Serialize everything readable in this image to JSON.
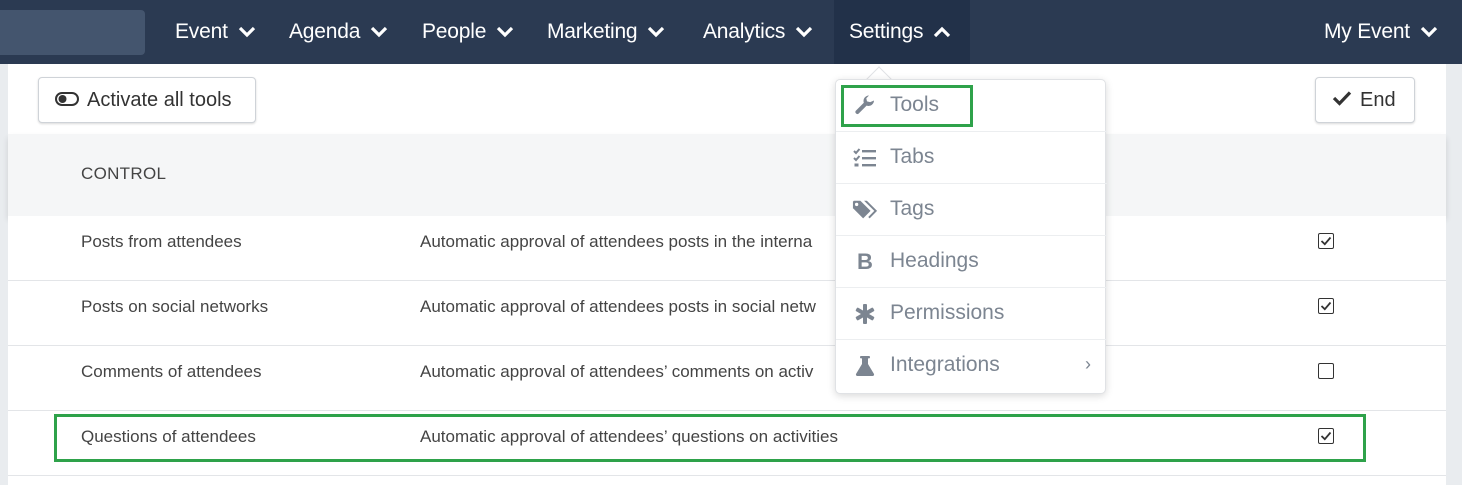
{
  "nav": {
    "items": [
      {
        "label": "Event"
      },
      {
        "label": "Agenda"
      },
      {
        "label": "People"
      },
      {
        "label": "Marketing"
      },
      {
        "label": "Analytics"
      },
      {
        "label": "Settings"
      }
    ],
    "event_selector": "My Event"
  },
  "toolbar": {
    "activate_label": "Activate all tools",
    "end_label": "End"
  },
  "table": {
    "header": "CONTROL",
    "rows": [
      {
        "name": "Posts from attendees",
        "description": "Automatic approval of attendees posts in the interna",
        "checked": true
      },
      {
        "name": "Posts on social networks",
        "description": "Automatic approval of attendees posts in social netw",
        "checked": true
      },
      {
        "name": "Comments of attendees",
        "description": "Automatic approval of attendees’ comments on activ",
        "checked": false
      },
      {
        "name": "Questions of attendees",
        "description": "Automatic approval of attendees’ questions on activities",
        "checked": true
      }
    ]
  },
  "settings_menu": {
    "items": [
      {
        "label": "Tools",
        "icon": "wrench-icon"
      },
      {
        "label": "Tabs",
        "icon": "checklist-icon"
      },
      {
        "label": "Tags",
        "icon": "tags-icon"
      },
      {
        "label": "Headings",
        "icon": "bold-icon"
      },
      {
        "label": "Permissions",
        "icon": "asterisk-icon"
      },
      {
        "label": "Integrations",
        "icon": "flask-icon",
        "submenu": true
      }
    ]
  },
  "colors": {
    "nav_bg": "#2b3a52",
    "highlight": "#2ea24a",
    "menu_text": "#7c8591"
  }
}
